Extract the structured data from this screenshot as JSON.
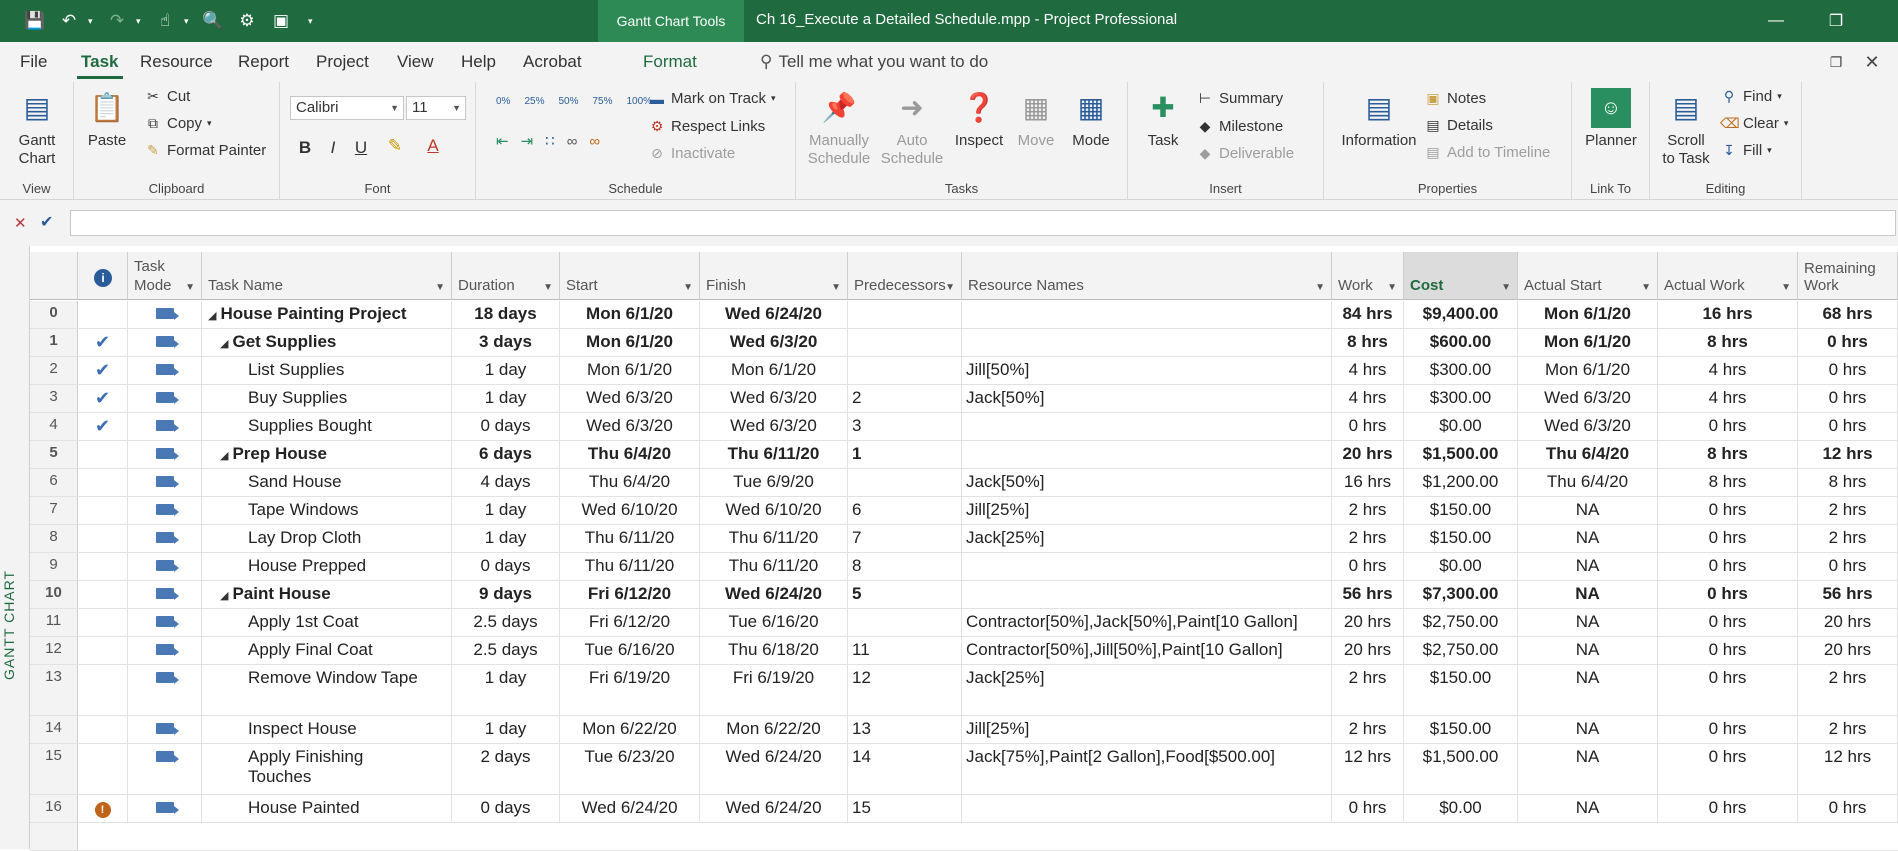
{
  "titlebar": {
    "context_tab": "Gantt Chart Tools",
    "document_title": "Ch 16_Execute a Detailed Schedule.mpp  -  Project Professional"
  },
  "menu": {
    "tabs": [
      "File",
      "Task",
      "Resource",
      "Report",
      "Project",
      "View",
      "Help",
      "Acrobat",
      "Format"
    ],
    "active": "Task",
    "tell_me": "Tell me what you want to do"
  },
  "ribbon": {
    "view": {
      "gantt_line1": "Gantt",
      "gantt_line2": "Chart",
      "label": "View"
    },
    "clipboard": {
      "paste": "Paste",
      "cut": "Cut",
      "copy": "Copy",
      "format_painter": "Format Painter",
      "label": "Clipboard"
    },
    "font": {
      "font_name": "Calibri",
      "font_size": "11",
      "bold": "B",
      "italic": "I",
      "underline": "U",
      "label": "Font"
    },
    "schedule": {
      "pct": [
        "0%",
        "25%",
        "50%",
        "75%",
        "100%"
      ],
      "mark_on_track": "Mark on Track",
      "respect_links": "Respect Links",
      "inactivate": "Inactivate",
      "label": "Schedule"
    },
    "tasks": {
      "manually_1": "Manually",
      "manually_2": "Schedule",
      "auto_1": "Auto",
      "auto_2": "Schedule",
      "inspect": "Inspect",
      "move": "Move",
      "mode": "Mode",
      "label": "Tasks"
    },
    "insert": {
      "task": "Task",
      "summary": "Summary",
      "milestone": "Milestone",
      "deliverable": "Deliverable",
      "label": "Insert"
    },
    "properties": {
      "information": "Information",
      "notes": "Notes",
      "details": "Details",
      "add_to_timeline": "Add to Timeline",
      "label": "Properties"
    },
    "linkto": {
      "planner": "Planner",
      "label": "Link To"
    },
    "editing": {
      "scroll_1": "Scroll",
      "scroll_2": "to Task",
      "find": "Find",
      "clear": "Clear",
      "fill": "Fill",
      "label": "Editing"
    }
  },
  "view_bar_label": "GANTT CHART",
  "columns": {
    "task_mode_1": "Task",
    "task_mode_2": "Mode",
    "task_name": "Task Name",
    "duration": "Duration",
    "start": "Start",
    "finish": "Finish",
    "predecessors": "Predecessors",
    "resource_names": "Resource Names",
    "work": "Work",
    "cost": "Cost",
    "actual_start": "Actual Start",
    "actual_work": "Actual Work",
    "remaining_work": "Remaining Work"
  },
  "rows": [
    {
      "id": "0",
      "ind": "",
      "name": "House Painting Project",
      "level": 0,
      "summary": true,
      "duration": "18 days",
      "start": "Mon 6/1/20",
      "finish": "Wed 6/24/20",
      "pred": "",
      "res": "",
      "work": "84 hrs",
      "cost": "$9,400.00",
      "astart": "Mon 6/1/20",
      "awork": "16 hrs",
      "rwork": "68 hrs"
    },
    {
      "id": "1",
      "ind": "check",
      "name": "Get Supplies",
      "level": 1,
      "summary": true,
      "duration": "3 days",
      "start": "Mon 6/1/20",
      "finish": "Wed 6/3/20",
      "pred": "",
      "res": "",
      "work": "8 hrs",
      "cost": "$600.00",
      "astart": "Mon 6/1/20",
      "awork": "8 hrs",
      "rwork": "0 hrs"
    },
    {
      "id": "2",
      "ind": "check",
      "name": "List Supplies",
      "level": 2,
      "summary": false,
      "duration": "1 day",
      "start": "Mon 6/1/20",
      "finish": "Mon 6/1/20",
      "pred": "",
      "res": "Jill[50%]",
      "work": "4 hrs",
      "cost": "$300.00",
      "astart": "Mon 6/1/20",
      "awork": "4 hrs",
      "rwork": "0 hrs"
    },
    {
      "id": "3",
      "ind": "check",
      "name": "Buy Supplies",
      "level": 2,
      "summary": false,
      "duration": "1 day",
      "start": "Wed 6/3/20",
      "finish": "Wed 6/3/20",
      "pred": "2",
      "res": "Jack[50%]",
      "work": "4 hrs",
      "cost": "$300.00",
      "astart": "Wed 6/3/20",
      "awork": "4 hrs",
      "rwork": "0 hrs"
    },
    {
      "id": "4",
      "ind": "check",
      "name": "Supplies Bought",
      "level": 2,
      "summary": false,
      "duration": "0 days",
      "start": "Wed 6/3/20",
      "finish": "Wed 6/3/20",
      "pred": "3",
      "res": "",
      "work": "0 hrs",
      "cost": "$0.00",
      "astart": "Wed 6/3/20",
      "awork": "0 hrs",
      "rwork": "0 hrs"
    },
    {
      "id": "5",
      "ind": "",
      "name": "Prep House",
      "level": 1,
      "summary": true,
      "duration": "6 days",
      "start": "Thu 6/4/20",
      "finish": "Thu 6/11/20",
      "pred": "1",
      "res": "",
      "work": "20 hrs",
      "cost": "$1,500.00",
      "astart": "Thu 6/4/20",
      "awork": "8 hrs",
      "rwork": "12 hrs"
    },
    {
      "id": "6",
      "ind": "",
      "name": "Sand House",
      "level": 2,
      "summary": false,
      "duration": "4 days",
      "start": "Thu 6/4/20",
      "finish": "Tue 6/9/20",
      "pred": "",
      "res": "Jack[50%]",
      "work": "16 hrs",
      "cost": "$1,200.00",
      "astart": "Thu 6/4/20",
      "awork": "8 hrs",
      "rwork": "8 hrs"
    },
    {
      "id": "7",
      "ind": "",
      "name": "Tape Windows",
      "level": 2,
      "summary": false,
      "duration": "1 day",
      "start": "Wed 6/10/20",
      "finish": "Wed 6/10/20",
      "pred": "6",
      "res": "Jill[25%]",
      "work": "2 hrs",
      "cost": "$150.00",
      "astart": "NA",
      "awork": "0 hrs",
      "rwork": "2 hrs"
    },
    {
      "id": "8",
      "ind": "",
      "name": "Lay Drop Cloth",
      "level": 2,
      "summary": false,
      "duration": "1 day",
      "start": "Thu 6/11/20",
      "finish": "Thu 6/11/20",
      "pred": "7",
      "res": "Jack[25%]",
      "work": "2 hrs",
      "cost": "$150.00",
      "astart": "NA",
      "awork": "0 hrs",
      "rwork": "2 hrs"
    },
    {
      "id": "9",
      "ind": "",
      "name": "House Prepped",
      "level": 2,
      "summary": false,
      "duration": "0 days",
      "start": "Thu 6/11/20",
      "finish": "Thu 6/11/20",
      "pred": "8",
      "res": "",
      "work": "0 hrs",
      "cost": "$0.00",
      "astart": "NA",
      "awork": "0 hrs",
      "rwork": "0 hrs"
    },
    {
      "id": "10",
      "ind": "",
      "name": "Paint House",
      "level": 1,
      "summary": true,
      "duration": "9 days",
      "start": "Fri 6/12/20",
      "finish": "Wed 6/24/20",
      "pred": "5",
      "res": "",
      "work": "56 hrs",
      "cost": "$7,300.00",
      "astart": "NA",
      "awork": "0 hrs",
      "rwork": "56 hrs"
    },
    {
      "id": "11",
      "ind": "",
      "name": "Apply 1st Coat",
      "level": 2,
      "summary": false,
      "duration": "2.5 days",
      "start": "Fri 6/12/20",
      "finish": "Tue 6/16/20",
      "pred": "",
      "res": "Contractor[50%],Jack[50%],Paint[10 Gallon]",
      "work": "20 hrs",
      "cost": "$2,750.00",
      "astart": "NA",
      "awork": "0 hrs",
      "rwork": "20 hrs"
    },
    {
      "id": "12",
      "ind": "",
      "name": "Apply Final Coat",
      "level": 2,
      "summary": false,
      "duration": "2.5 days",
      "start": "Tue 6/16/20",
      "finish": "Thu 6/18/20",
      "pred": "11",
      "res": "Contractor[50%],Jill[50%],Paint[10 Gallon]",
      "work": "20 hrs",
      "cost": "$2,750.00",
      "astart": "NA",
      "awork": "0 hrs",
      "rwork": "20 hrs"
    },
    {
      "id": "13",
      "ind": "",
      "name": "Remove Window Tape",
      "level": 2,
      "summary": false,
      "duration": "1 day",
      "start": "Fri 6/19/20",
      "finish": "Fri 6/19/20",
      "pred": "12",
      "res": "Jack[25%]",
      "work": "2 hrs",
      "cost": "$150.00",
      "astart": "NA",
      "awork": "0 hrs",
      "rwork": "2 hrs",
      "tall": true
    },
    {
      "id": "14",
      "ind": "",
      "name": "Inspect House",
      "level": 2,
      "summary": false,
      "duration": "1 day",
      "start": "Mon 6/22/20",
      "finish": "Mon 6/22/20",
      "pred": "13",
      "res": "Jill[25%]",
      "work": "2 hrs",
      "cost": "$150.00",
      "astart": "NA",
      "awork": "0 hrs",
      "rwork": "2 hrs"
    },
    {
      "id": "15",
      "ind": "",
      "name": "Apply Finishing",
      "name2": "Touches",
      "level": 2,
      "summary": false,
      "duration": "2 days",
      "start": "Tue 6/23/20",
      "finish": "Wed 6/24/20",
      "pred": "14",
      "res": "Jack[75%],Paint[2 Gallon],Food[$500.00]",
      "work": "12 hrs",
      "cost": "$1,500.00",
      "astart": "NA",
      "awork": "0 hrs",
      "rwork": "12 hrs",
      "tall": true
    },
    {
      "id": "16",
      "ind": "warn",
      "name": "House Painted",
      "level": 2,
      "summary": false,
      "duration": "0 days",
      "start": "Wed 6/24/20",
      "finish": "Wed 6/24/20",
      "pred": "15",
      "res": "",
      "work": "0 hrs",
      "cost": "$0.00",
      "astart": "NA",
      "awork": "0 hrs",
      "rwork": "0 hrs"
    }
  ]
}
